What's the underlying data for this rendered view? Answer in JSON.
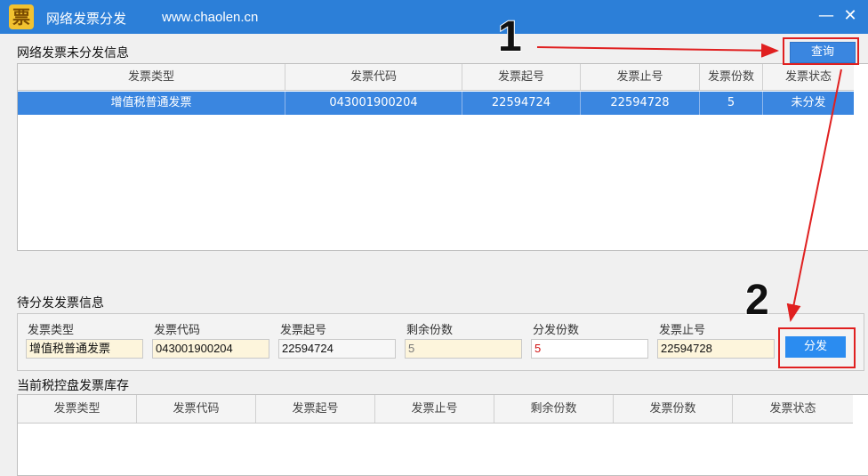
{
  "window": {
    "logo_char": "票",
    "title": "网络发票分发",
    "url": "www.chaolen.cn",
    "minimize_glyph": "—",
    "close_glyph": "✕"
  },
  "unissued": {
    "section_label": "网络发票未分发信息",
    "query_button": "查询",
    "columns": [
      "发票类型",
      "发票代码",
      "发票起号",
      "发票止号",
      "发票份数",
      "发票状态"
    ],
    "rows": [
      [
        "增值税普通发票",
        "043001900204",
        "22594724",
        "22594728",
        "5",
        "未分发"
      ]
    ]
  },
  "pending": {
    "section_label": "待分发发票信息",
    "fields": [
      {
        "label": "发票类型",
        "value": "增值税普通发票"
      },
      {
        "label": "发票代码",
        "value": "043001900204"
      },
      {
        "label": "发票起号",
        "value": "22594724"
      },
      {
        "label": "剩余份数",
        "value": "5"
      },
      {
        "label": "分发份数",
        "value": "5"
      },
      {
        "label": "发票止号",
        "value": "22594728"
      }
    ],
    "dispatch_button": "分发"
  },
  "inventory": {
    "section_label": "当前税控盘发票库存",
    "columns": [
      "发票类型",
      "发票代码",
      "发票起号",
      "发票止号",
      "剩余份数",
      "发票份数",
      "发票状态"
    ]
  },
  "annotations": {
    "step1": "1",
    "step2": "2",
    "color": "#e02020"
  }
}
